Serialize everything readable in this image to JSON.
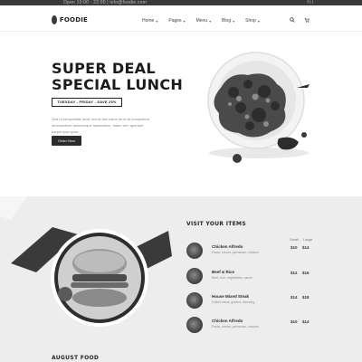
{
  "topbar": {
    "left_text": "Open 10:00 - 22:00  |  info@foodie.com",
    "social": "f t i"
  },
  "brand": {
    "name": "FOODIE"
  },
  "nav": {
    "items": [
      {
        "label": "Home"
      },
      {
        "label": "Pages"
      },
      {
        "label": "Menu"
      },
      {
        "label": "Blog"
      },
      {
        "label": "Shop"
      }
    ],
    "dropdown_glyph": "▾"
  },
  "hero": {
    "title_line1": "SUPER DEAL",
    "title_line2": "SPECIAL LUNCH",
    "tagline": "TUESDAY - FRIDAY - SAVE 25%",
    "description": "Sed ut perspiciatis unde omnis iste natus error sit voluptatem accusantium doloremque laudantium, totam rem aperiam eaque ipsa quae.",
    "cta_label": "Order Now"
  },
  "menu": {
    "heading": "VISIT YOUR ITEMS",
    "col_small": "Small",
    "col_large": "Large",
    "items": [
      {
        "name": "Chicken Alfredo",
        "desc": "Pasta, cream, parmesan, chicken",
        "price_small": "$10",
        "price_large": "$14"
      },
      {
        "name": "Beef & Rice",
        "desc": "Beef, rice, vegetables, sauce",
        "price_small": "$12",
        "price_large": "$16"
      },
      {
        "name": "House Mixed Steak",
        "desc": "Grilled steak, greens, dressing",
        "price_small": "$14",
        "price_large": "$18"
      },
      {
        "name": "Chicken Alfredo",
        "desc": "Pasta, cream, parmesan, chicken",
        "price_small": "$10",
        "price_large": "$14"
      }
    ]
  },
  "bottom": {
    "heading": "AUGUST FOOD"
  },
  "colors": {
    "dark": "#2b2b2b",
    "band": "#ededed",
    "topbar": "#3a3a3a"
  }
}
